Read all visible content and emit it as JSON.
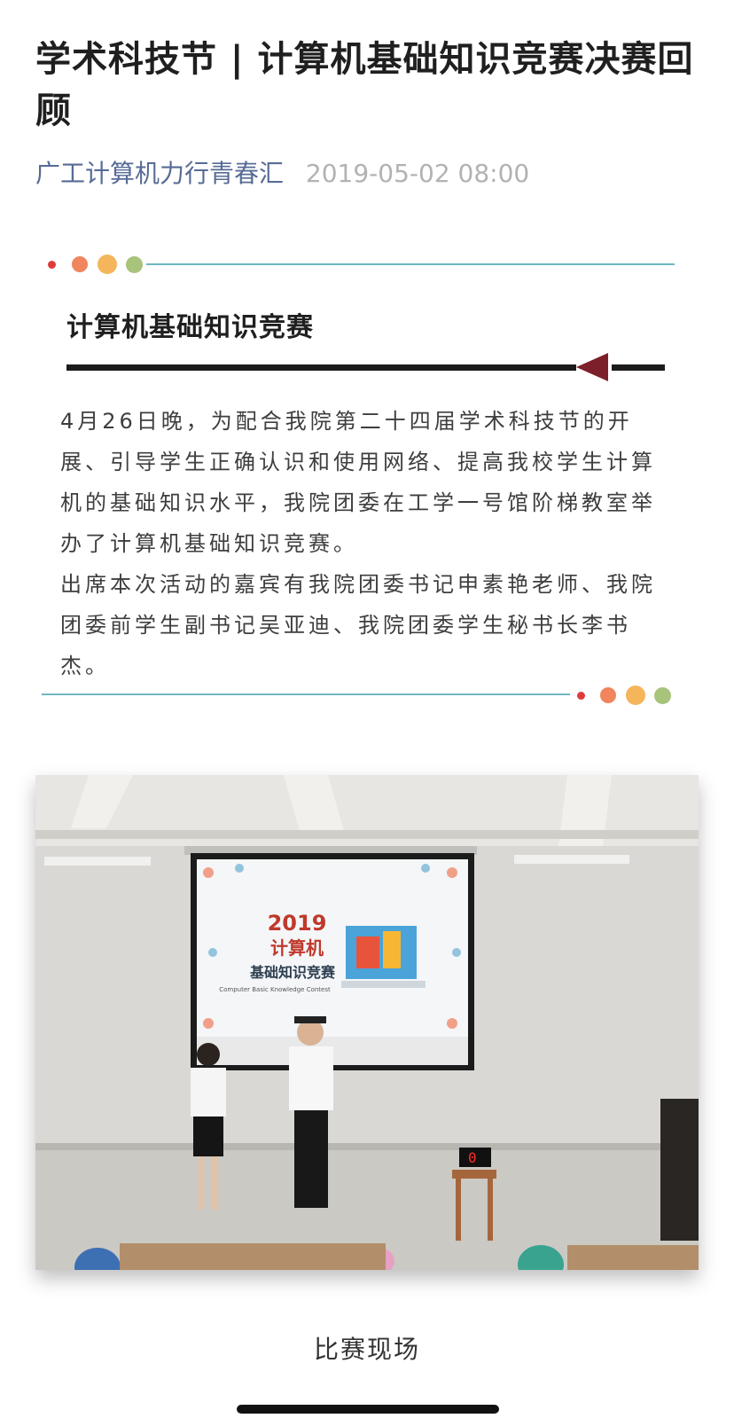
{
  "article": {
    "title": "学术科技节 | 计算机基础知识竞赛决赛回顾",
    "account_name": "广工计算机力行青春汇",
    "publish_time": "2019-05-02 08:00"
  },
  "section": {
    "heading": "计算机基础知识竞赛",
    "paragraph": "4月26日晚，为配合我院第二十四届学术科技节的开展、引导学生正确认识和使用网络、提高我校学生计算机的基础知识水平，我院团委在工学一号馆阶梯教室举办了计算机基础知识竞赛。\n出席本次活动的嘉宾有我院团委书记申素艳老师、我院团委前学生副书记吴亚迪、我院团委学生秘书长李书杰。"
  },
  "photo": {
    "screen_year": "2019",
    "screen_line1": "计算机",
    "screen_line2": "基础知识竞赛",
    "screen_subtitle": "Computer Basic Knowledge Contest",
    "timer": "0"
  },
  "caption": "比赛现场",
  "colors": {
    "dot_red": "#e03b3b",
    "dot_orange": "#f0855e",
    "dot_yellow": "#f5b55a",
    "dot_green": "#a8c37b",
    "divider": "#6fb6c2",
    "arrow": "#7d1f2a"
  }
}
